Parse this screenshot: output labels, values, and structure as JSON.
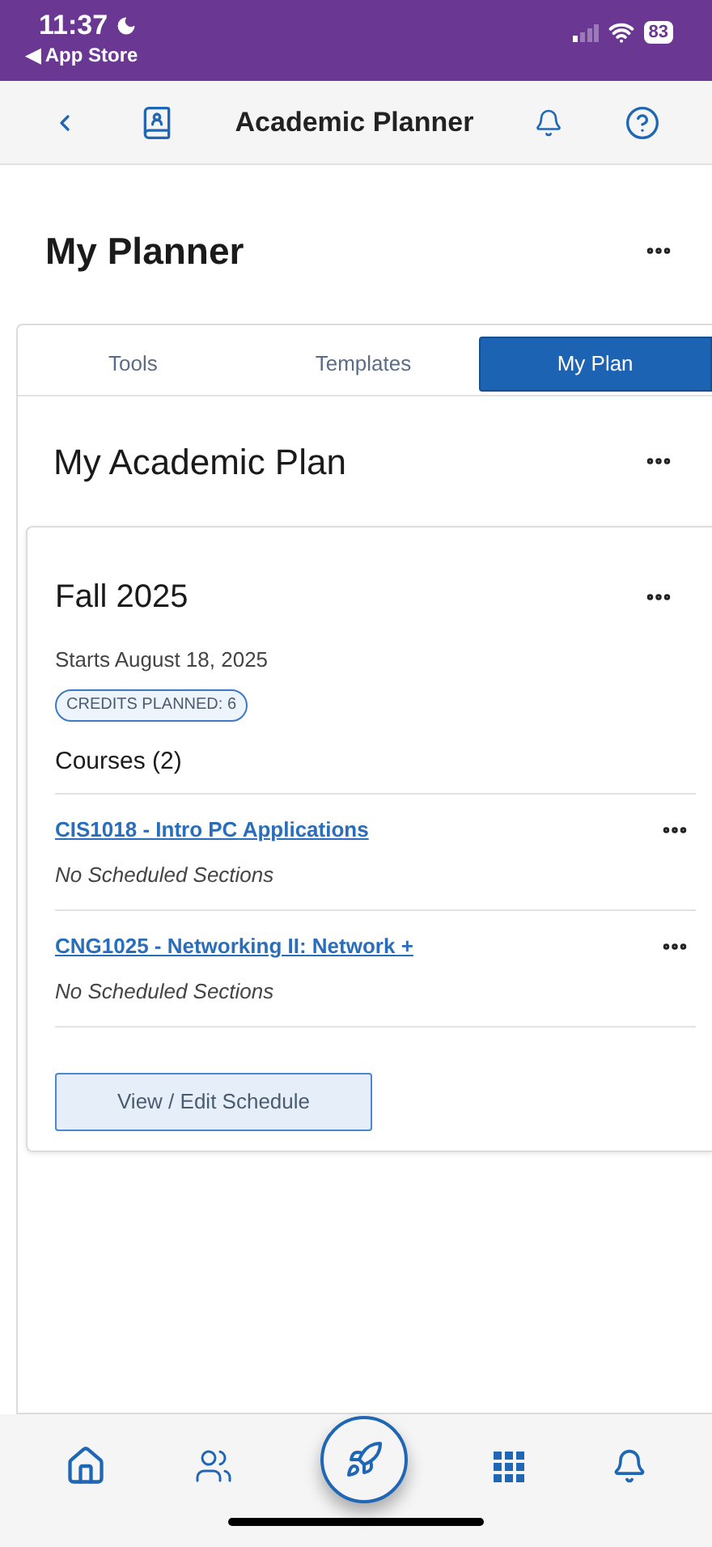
{
  "status_bar": {
    "time": "11:37",
    "back_app": "◀ App Store",
    "battery": "83"
  },
  "nav_bar": {
    "title": "Academic Planner"
  },
  "page_title": "My Planner",
  "tabs": [
    {
      "label": "Tools",
      "selected": false
    },
    {
      "label": "Templates",
      "selected": false
    },
    {
      "label": "My Plan",
      "selected": true
    }
  ],
  "plan": {
    "title": "My Academic Plan",
    "term": {
      "title": "Fall 2025",
      "starts": "Starts August 18, 2025",
      "credits_badge": "CREDITS PLANNED: 6",
      "courses_heading": "Courses (2)",
      "courses": [
        {
          "name": "CIS1018 - Intro PC Applications",
          "sections": "No Scheduled Sections"
        },
        {
          "name": "CNG1025 - Networking II: Network +",
          "sections": "No Scheduled Sections"
        }
      ],
      "button": "View / Edit Schedule"
    }
  },
  "bottom_nav": [
    {
      "kind": "home"
    },
    {
      "kind": "people"
    },
    {
      "kind": "rocket"
    },
    {
      "kind": "grid"
    },
    {
      "kind": "bell"
    }
  ]
}
